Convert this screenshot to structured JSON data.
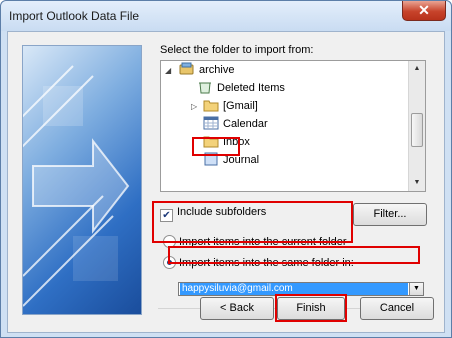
{
  "window": {
    "title": "Import Outlook Data File",
    "close_symbol": "✕"
  },
  "prompt": "Select the folder to import from:",
  "tree": {
    "items": [
      {
        "label": "archive",
        "icon": "data-file-icon"
      },
      {
        "label": "Deleted Items",
        "icon": "deleted-items-icon"
      },
      {
        "label": "[Gmail]",
        "icon": "folder-icon"
      },
      {
        "label": "Calendar",
        "icon": "calendar-icon"
      },
      {
        "label": "Inbox",
        "icon": "folder-icon"
      },
      {
        "label": "Journal",
        "icon": "journal-icon"
      }
    ],
    "expand_open": "◢",
    "expand_closed": "▷",
    "scroll_up": "▲",
    "scroll_down": "▼"
  },
  "include_subfolders": {
    "label": "Include subfolders",
    "checked": true,
    "mark": "✔"
  },
  "filter_button": "Filter...",
  "radio": {
    "current": {
      "label": "Import items into the current folder",
      "selected": false
    },
    "same": {
      "label": "Import items into the same folder in:",
      "selected": true
    }
  },
  "target_combo": {
    "value": "happysiluvia@gmail.com",
    "arrow": "▼"
  },
  "buttons": {
    "back": "< Back",
    "finish": "Finish",
    "cancel": "Cancel"
  },
  "colors": {
    "highlight": "#e00000",
    "selection": "#3399ff",
    "close": "#c7432b"
  }
}
